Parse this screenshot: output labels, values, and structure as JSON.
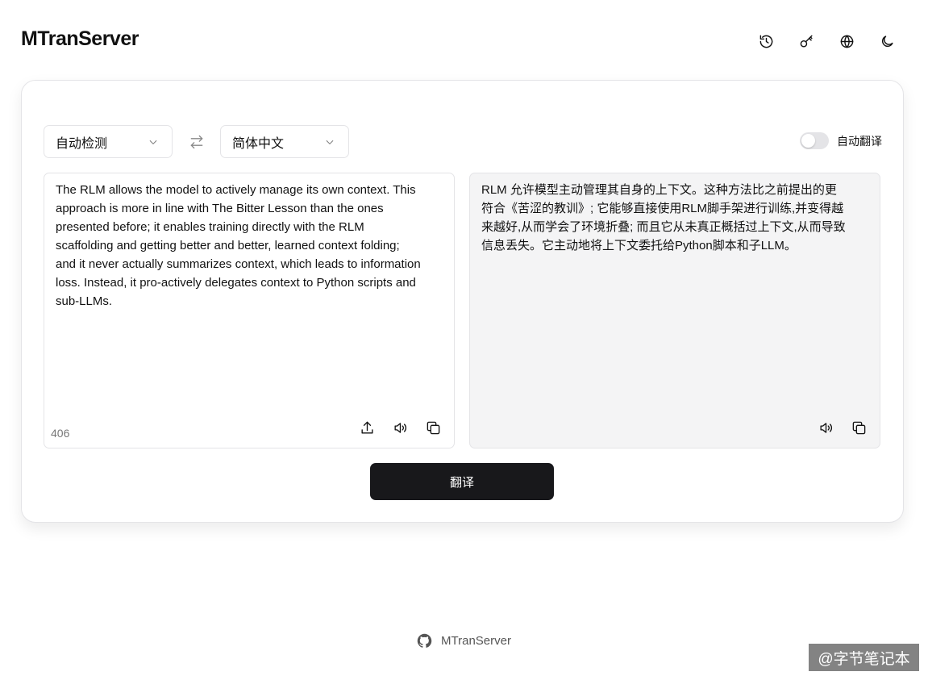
{
  "header": {
    "title": "MTranServer",
    "icons": [
      "history-icon",
      "key-icon",
      "globe-icon",
      "moon-icon"
    ]
  },
  "languages": {
    "source": "自动检测",
    "target": "简体中文",
    "auto_translate_label": "自动翻译",
    "auto_translate_enabled": false
  },
  "source_panel": {
    "text": "The RLM allows the model to actively manage its own context. This\napproach is more in line with The Bitter Lesson than the ones\npresented before; it enables training directly with the RLM\nscaffolding and getting better and better, learned context folding;\nand it never actually summarizes context, which leads to information\nloss. Instead, it pro-actively delegates context to Python scripts and\nsub-LLMs.",
    "char_count": "406"
  },
  "target_panel": {
    "text": "RLM 允许模型主动管理其自身的上下文。这种方法比之前提出的更\n符合《苦涩的教训》; 它能够直接使用RLM脚手架进行训练,并变得越\n来越好,从而学会了环境折叠; 而且它从未真正概括过上下文,从而导致\n信息丢失。它主动地将上下文委托给Python脚本和子LLM。"
  },
  "actions": {
    "translate_label": "翻译"
  },
  "footer": {
    "label": "MTranServer"
  },
  "watermark": "@字节笔记本",
  "colors": {
    "primary_button": "#18181b",
    "target_panel_bg": "#f4f4f5",
    "border": "#e4e4e7"
  }
}
